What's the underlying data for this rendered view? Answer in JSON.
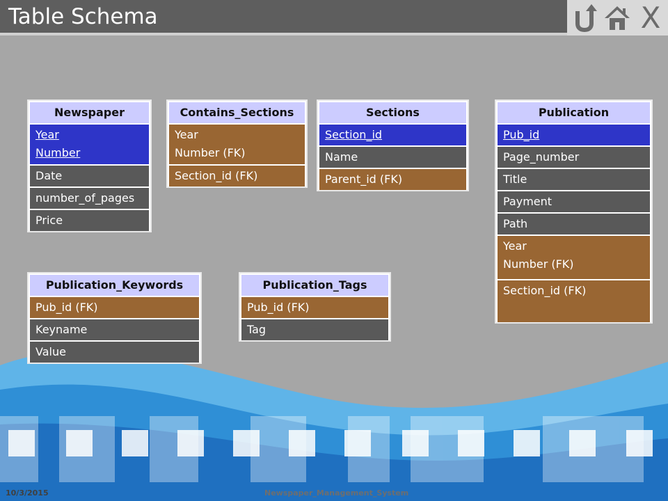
{
  "header": {
    "title": "Table Schema"
  },
  "nav": {
    "close_label": "X"
  },
  "tables": {
    "newspaper": {
      "name": "Newspaper",
      "pk": [
        "Year",
        "Number"
      ],
      "fields": [
        "Date",
        "number_of_pages",
        "Price"
      ]
    },
    "contains_sections": {
      "name": "Contains_Sections",
      "fk_group": [
        "Year",
        "Number (FK)"
      ],
      "fk_single": "Section_id (FK)"
    },
    "sections": {
      "name": "Sections",
      "pk": "Section_id",
      "fields": [
        "Name"
      ],
      "fk": "Parent_id (FK)"
    },
    "publication": {
      "name": "Publication",
      "pk": "Pub_id",
      "fields": [
        "Page_number",
        "Title",
        "Payment",
        "Path"
      ],
      "fk_group": [
        "Year",
        "Number (FK)"
      ],
      "fk_single": "Section_id (FK)"
    },
    "publication_keywords": {
      "name": "Publication_Keywords",
      "fk": "Pub_id (FK)",
      "fields": [
        "Keyname",
        "Value"
      ]
    },
    "publication_tags": {
      "name": "Publication_Tags",
      "fk": "Pub_id (FK)",
      "fields": [
        "Tag"
      ]
    }
  },
  "footer": {
    "date": "10/3/2015",
    "title": "Newspaper_Management_System"
  },
  "colors": {
    "header_row": "#ccccff",
    "primary_key": "#2e35c8",
    "foreign_key": "#996633",
    "plain_field": "#595959"
  }
}
